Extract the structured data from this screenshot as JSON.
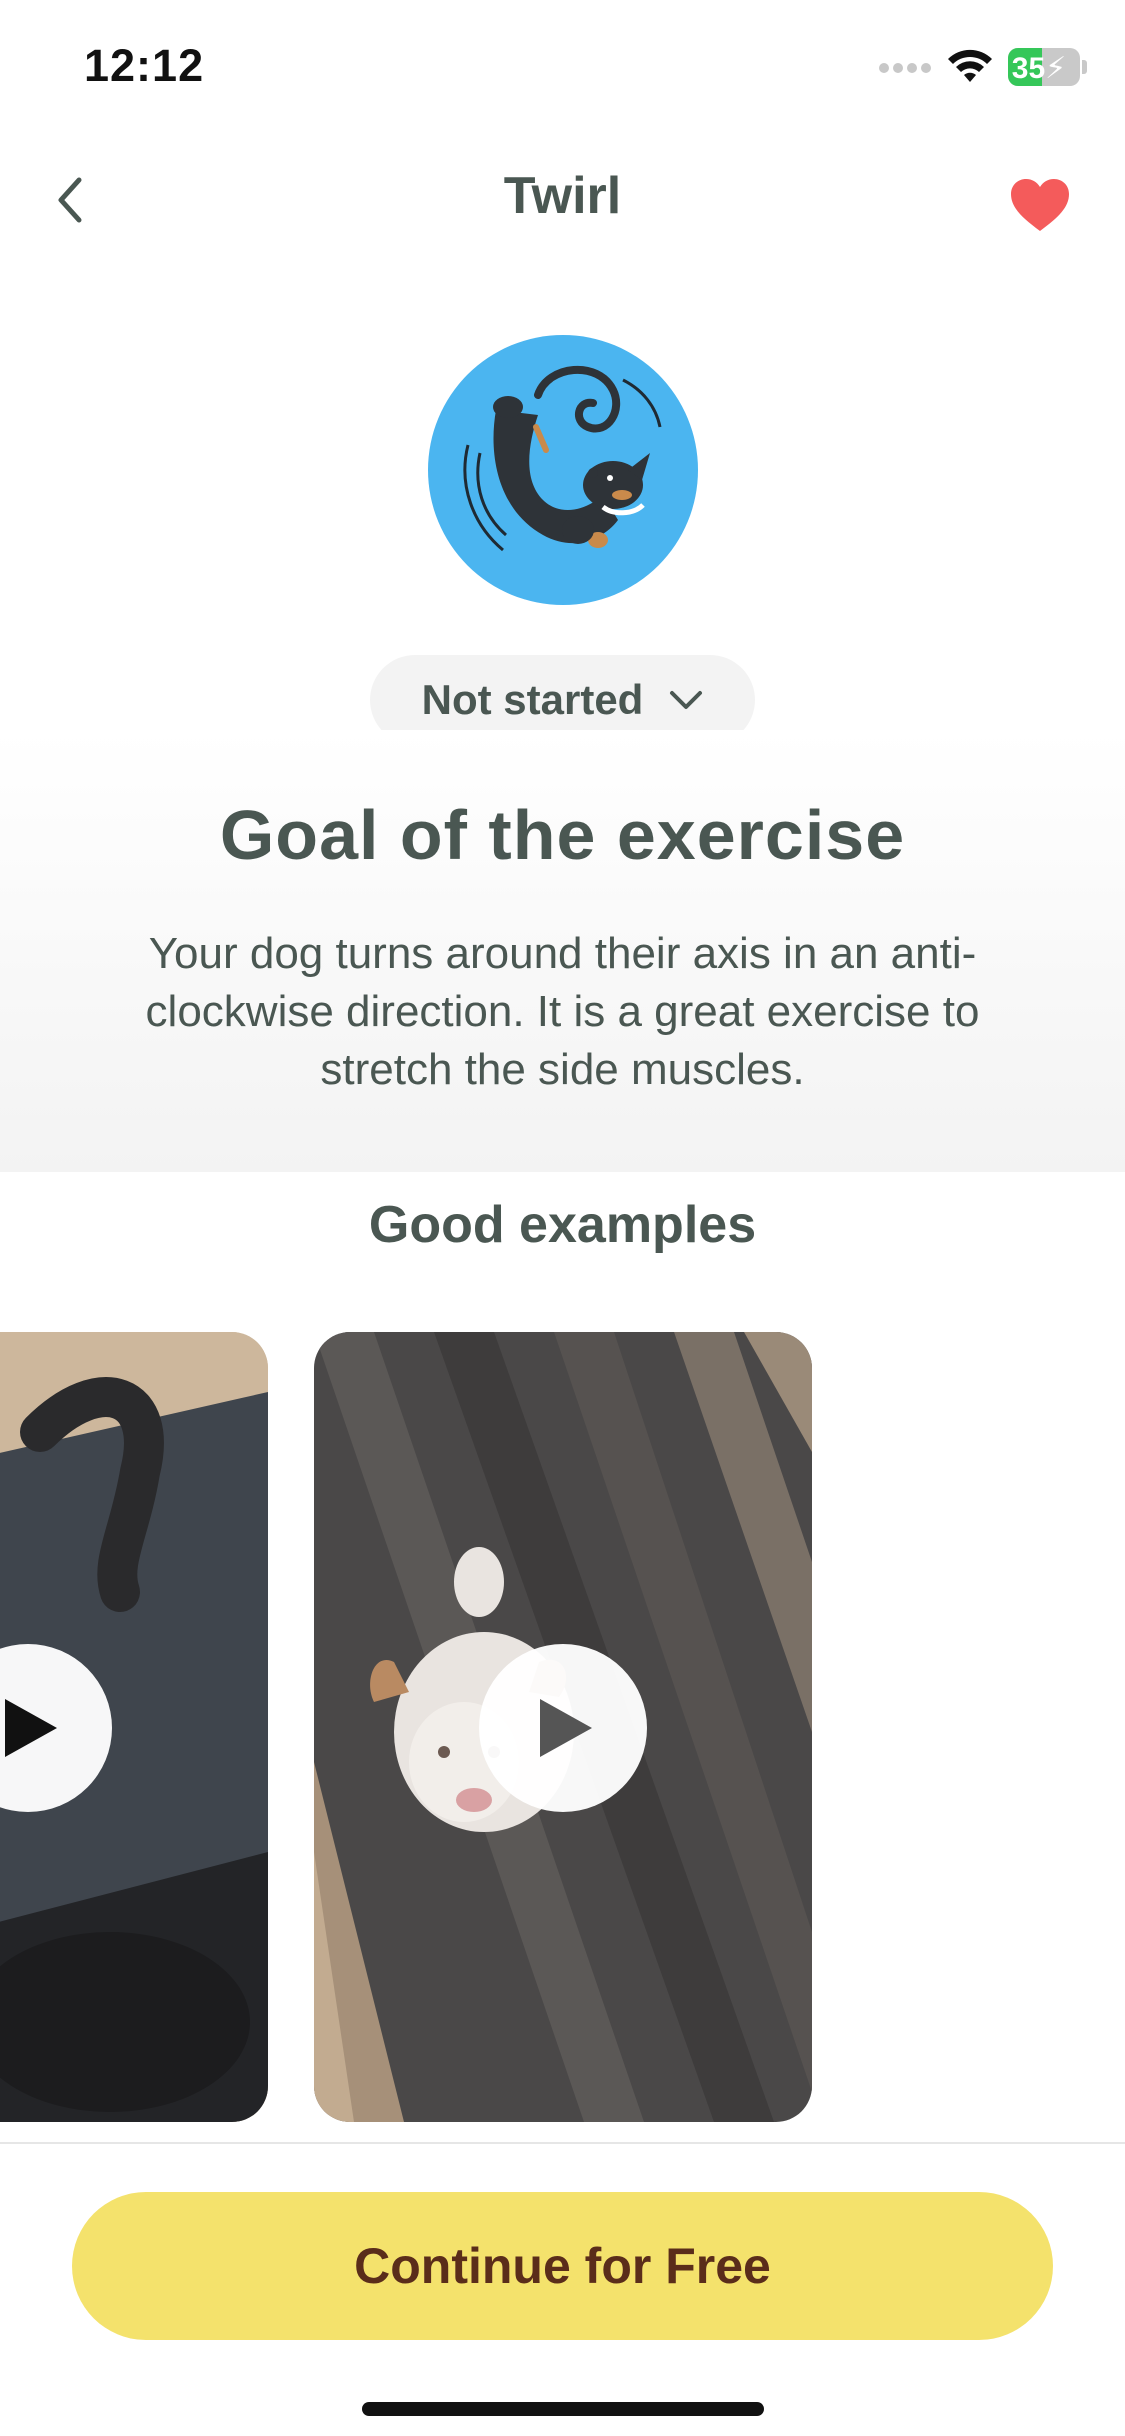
{
  "status_bar": {
    "time": "12:12",
    "battery_level": "35",
    "battery_color": "#35c759",
    "icons": [
      "cellular-signal-icon",
      "wifi-icon",
      "battery-charging-icon"
    ]
  },
  "nav": {
    "title": "Twirl",
    "back_icon": "chevron-left-icon",
    "favorite_icon": "heart-icon",
    "favorite_color": "#f45b5b"
  },
  "exercise": {
    "avatar_icon": "twirling-dog-illustration",
    "avatar_bg": "#4bb5f0",
    "status": "Not started",
    "status_icon": "chevron-down-icon"
  },
  "goal": {
    "heading": "Goal of the exercise",
    "description": "Your dog turns around their axis in an anti-clockwise direction. It is a great exercise to stretch the side muscles."
  },
  "examples": {
    "heading": "Good examples",
    "videos": [
      {
        "play_icon": "play-icon"
      },
      {
        "play_icon": "play-icon"
      }
    ]
  },
  "cta": {
    "label": "Continue for Free",
    "color": "#f4e26c"
  }
}
